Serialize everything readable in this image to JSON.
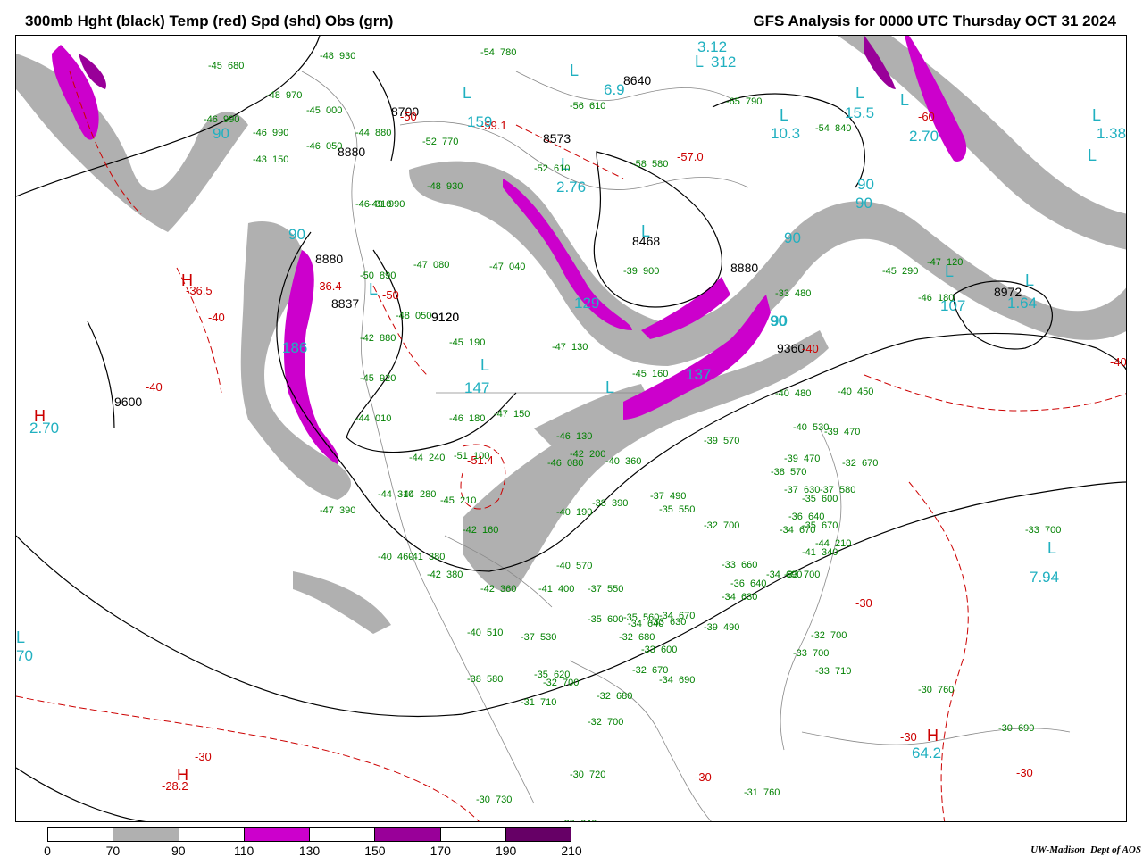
{
  "header": {
    "left_title": "300mb Hght (black) Temp (red) Spd (shd) Obs (grn)",
    "right_title": "GFS Analysis for 0000 UTC Thursday  OCT 31 2024"
  },
  "colors": {
    "height_contours": "#000000",
    "temp_contours": "#cc0000",
    "obs": "#008000",
    "speed_labels": "#20b0c0",
    "speed_70_90": "#b0b0b0",
    "speed_90_110": "#ffffff",
    "speed_110_130": "#cc00cc",
    "speed_130_150": "#ffffff",
    "speed_150_170": "#990099",
    "speed_170_190": "#ffffff",
    "speed_190_210": "#660066",
    "map_outlines": "#888888"
  },
  "map": {
    "height_labels": [
      "8700",
      "8880",
      "8573",
      "8640",
      "8468",
      "8880",
      "9120",
      "8880",
      "8837",
      "9600",
      "9360",
      "8972",
      "9120"
    ],
    "temp_labels": [
      "-36.5",
      "-40",
      "-40",
      "-36.4",
      "-50",
      "-50",
      "-59.1",
      "-57.0",
      "-60",
      "-40",
      "-51.4",
      "-40",
      "-30",
      "-28.2",
      "-30",
      "-30",
      "-30",
      "-30"
    ],
    "pressure_centers": [
      "H",
      "H",
      "L",
      "L",
      "L",
      "L",
      "L",
      "L",
      "L",
      "L",
      "L",
      "H",
      "L",
      "L",
      "L",
      "H",
      "L",
      "L",
      "L",
      "L",
      "L"
    ],
    "speed_labels": [
      "90",
      "159",
      "6.9",
      "312",
      "10.3",
      "15.5",
      "1.38",
      "2.70",
      "129",
      "147",
      "137",
      "90",
      "90",
      "90",
      "107",
      "1.64",
      "7.94",
      "64.2",
      "70",
      "2.76",
      "3.12",
      "2.70",
      "90",
      "186",
      "90",
      "90"
    ],
    "observations": [
      {
        "t": "-48",
        "h": "930"
      },
      {
        "t": "-45",
        "h": "680"
      },
      {
        "t": "-48",
        "h": "970"
      },
      {
        "t": "-46",
        "h": "990"
      },
      {
        "t": "-46",
        "h": "990"
      },
      {
        "t": "-45",
        "h": "000"
      },
      {
        "t": "-44",
        "h": "880"
      },
      {
        "t": "-46",
        "h": "050"
      },
      {
        "t": "-43",
        "h": "150"
      },
      {
        "t": "-54",
        "h": "780"
      },
      {
        "t": "-52",
        "h": "770"
      },
      {
        "t": "-56",
        "h": "610"
      },
      {
        "t": "-52",
        "h": "610"
      },
      {
        "t": "-58",
        "h": "580"
      },
      {
        "t": "-65",
        "h": "790"
      },
      {
        "t": "-54",
        "h": "840"
      },
      {
        "t": "-48",
        "h": "930"
      },
      {
        "t": "-46",
        "h": "010"
      },
      {
        "t": "-49",
        "h": "990"
      },
      {
        "t": "-47",
        "h": "080"
      },
      {
        "t": "-47",
        "h": "040"
      },
      {
        "t": "-50",
        "h": "890"
      },
      {
        "t": "-48",
        "h": "050"
      },
      {
        "t": "-42",
        "h": "880"
      },
      {
        "t": "-45",
        "h": "190"
      },
      {
        "t": "-45",
        "h": "920"
      },
      {
        "t": "-44",
        "h": "010"
      },
      {
        "t": "-47",
        "h": "130"
      },
      {
        "t": "-45",
        "h": "160"
      },
      {
        "t": "-46",
        "h": "180"
      },
      {
        "t": "-47",
        "h": "150"
      },
      {
        "t": "-46",
        "h": "130"
      },
      {
        "t": "-42",
        "h": "200"
      },
      {
        "t": "-40",
        "h": "360"
      },
      {
        "t": "-46",
        "h": "080"
      },
      {
        "t": "-51",
        "h": "100"
      },
      {
        "t": "-44",
        "h": "240"
      },
      {
        "t": "-44",
        "h": "310"
      },
      {
        "t": "-44",
        "h": "280"
      },
      {
        "t": "-45",
        "h": "210"
      },
      {
        "t": "-47",
        "h": "390"
      },
      {
        "t": "-42",
        "h": "160"
      },
      {
        "t": "-40",
        "h": "190"
      },
      {
        "t": "-38",
        "h": "390"
      },
      {
        "t": "-37",
        "h": "490"
      },
      {
        "t": "-35",
        "h": "550"
      },
      {
        "t": "-40",
        "h": "570"
      },
      {
        "t": "-40",
        "h": "460"
      },
      {
        "t": "-41",
        "h": "380"
      },
      {
        "t": "-42",
        "h": "380"
      },
      {
        "t": "-42",
        "h": "360"
      },
      {
        "t": "-41",
        "h": "400"
      },
      {
        "t": "-37",
        "h": "550"
      },
      {
        "t": "-35",
        "h": "560"
      },
      {
        "t": "-33",
        "h": "630"
      },
      {
        "t": "-33",
        "h": "660"
      },
      {
        "t": "-34",
        "h": "630"
      },
      {
        "t": "-36",
        "h": "640"
      },
      {
        "t": "-34",
        "h": "690"
      },
      {
        "t": "-39",
        "h": "490"
      },
      {
        "t": "-40",
        "h": "510"
      },
      {
        "t": "-37",
        "h": "530"
      },
      {
        "t": "-35",
        "h": "600"
      },
      {
        "t": "-34",
        "h": "640"
      },
      {
        "t": "-34",
        "h": "670"
      },
      {
        "t": "-33",
        "h": "600"
      },
      {
        "t": "-38",
        "h": "580"
      },
      {
        "t": "-35",
        "h": "620"
      },
      {
        "t": "-32",
        "h": "670"
      },
      {
        "t": "-34",
        "h": "690"
      },
      {
        "t": "-32",
        "h": "680"
      },
      {
        "t": "-32",
        "h": "700"
      },
      {
        "t": "-33",
        "h": "700"
      },
      {
        "t": "-32",
        "h": "700"
      },
      {
        "t": "-33",
        "h": "710"
      },
      {
        "t": "-32",
        "h": "700"
      },
      {
        "t": "-31",
        "h": "710"
      },
      {
        "t": "-30",
        "h": "720"
      },
      {
        "t": "-30",
        "h": "730"
      },
      {
        "t": "-29",
        "h": "640"
      },
      {
        "t": "-30",
        "h": "720"
      },
      {
        "t": "-31",
        "h": "760"
      },
      {
        "t": "-30",
        "h": "760"
      },
      {
        "t": "-30",
        "h": "690"
      },
      {
        "t": "-32",
        "h": "680"
      },
      {
        "t": "-32",
        "h": "670"
      },
      {
        "t": "-40",
        "h": "450"
      },
      {
        "t": "-40",
        "h": "480"
      },
      {
        "t": "-39",
        "h": "470"
      },
      {
        "t": "-40",
        "h": "530"
      },
      {
        "t": "-39",
        "h": "570"
      },
      {
        "t": "-39",
        "h": "470"
      },
      {
        "t": "-38",
        "h": "570"
      },
      {
        "t": "-37",
        "h": "580"
      },
      {
        "t": "-37",
        "h": "630"
      },
      {
        "t": "-36",
        "h": "640"
      },
      {
        "t": "-35",
        "h": "600"
      },
      {
        "t": "-34",
        "h": "670"
      },
      {
        "t": "-35",
        "h": "670"
      },
      {
        "t": "-33",
        "h": "700"
      },
      {
        "t": "-41",
        "h": "340"
      },
      {
        "t": "-44",
        "h": "210"
      },
      {
        "t": "-45",
        "h": "290"
      },
      {
        "t": "-46",
        "h": "180"
      },
      {
        "t": "-47",
        "h": "120"
      },
      {
        "t": "-39",
        "h": "900"
      },
      {
        "t": "-33",
        "h": "480"
      },
      {
        "t": "-32",
        "h": "700"
      },
      {
        "t": "-33",
        "h": "700"
      }
    ]
  },
  "legend": {
    "ticks": [
      "0",
      "70",
      "90",
      "110",
      "130",
      "150",
      "170",
      "190",
      "210"
    ],
    "segment_colors": [
      "#ffffff",
      "#b0b0b0",
      "#ffffff",
      "#cc00cc",
      "#ffffff",
      "#990099",
      "#ffffff",
      "#660066"
    ]
  },
  "credit": {
    "org": "UW-Madison",
    "dept": "Dept of AOS"
  }
}
